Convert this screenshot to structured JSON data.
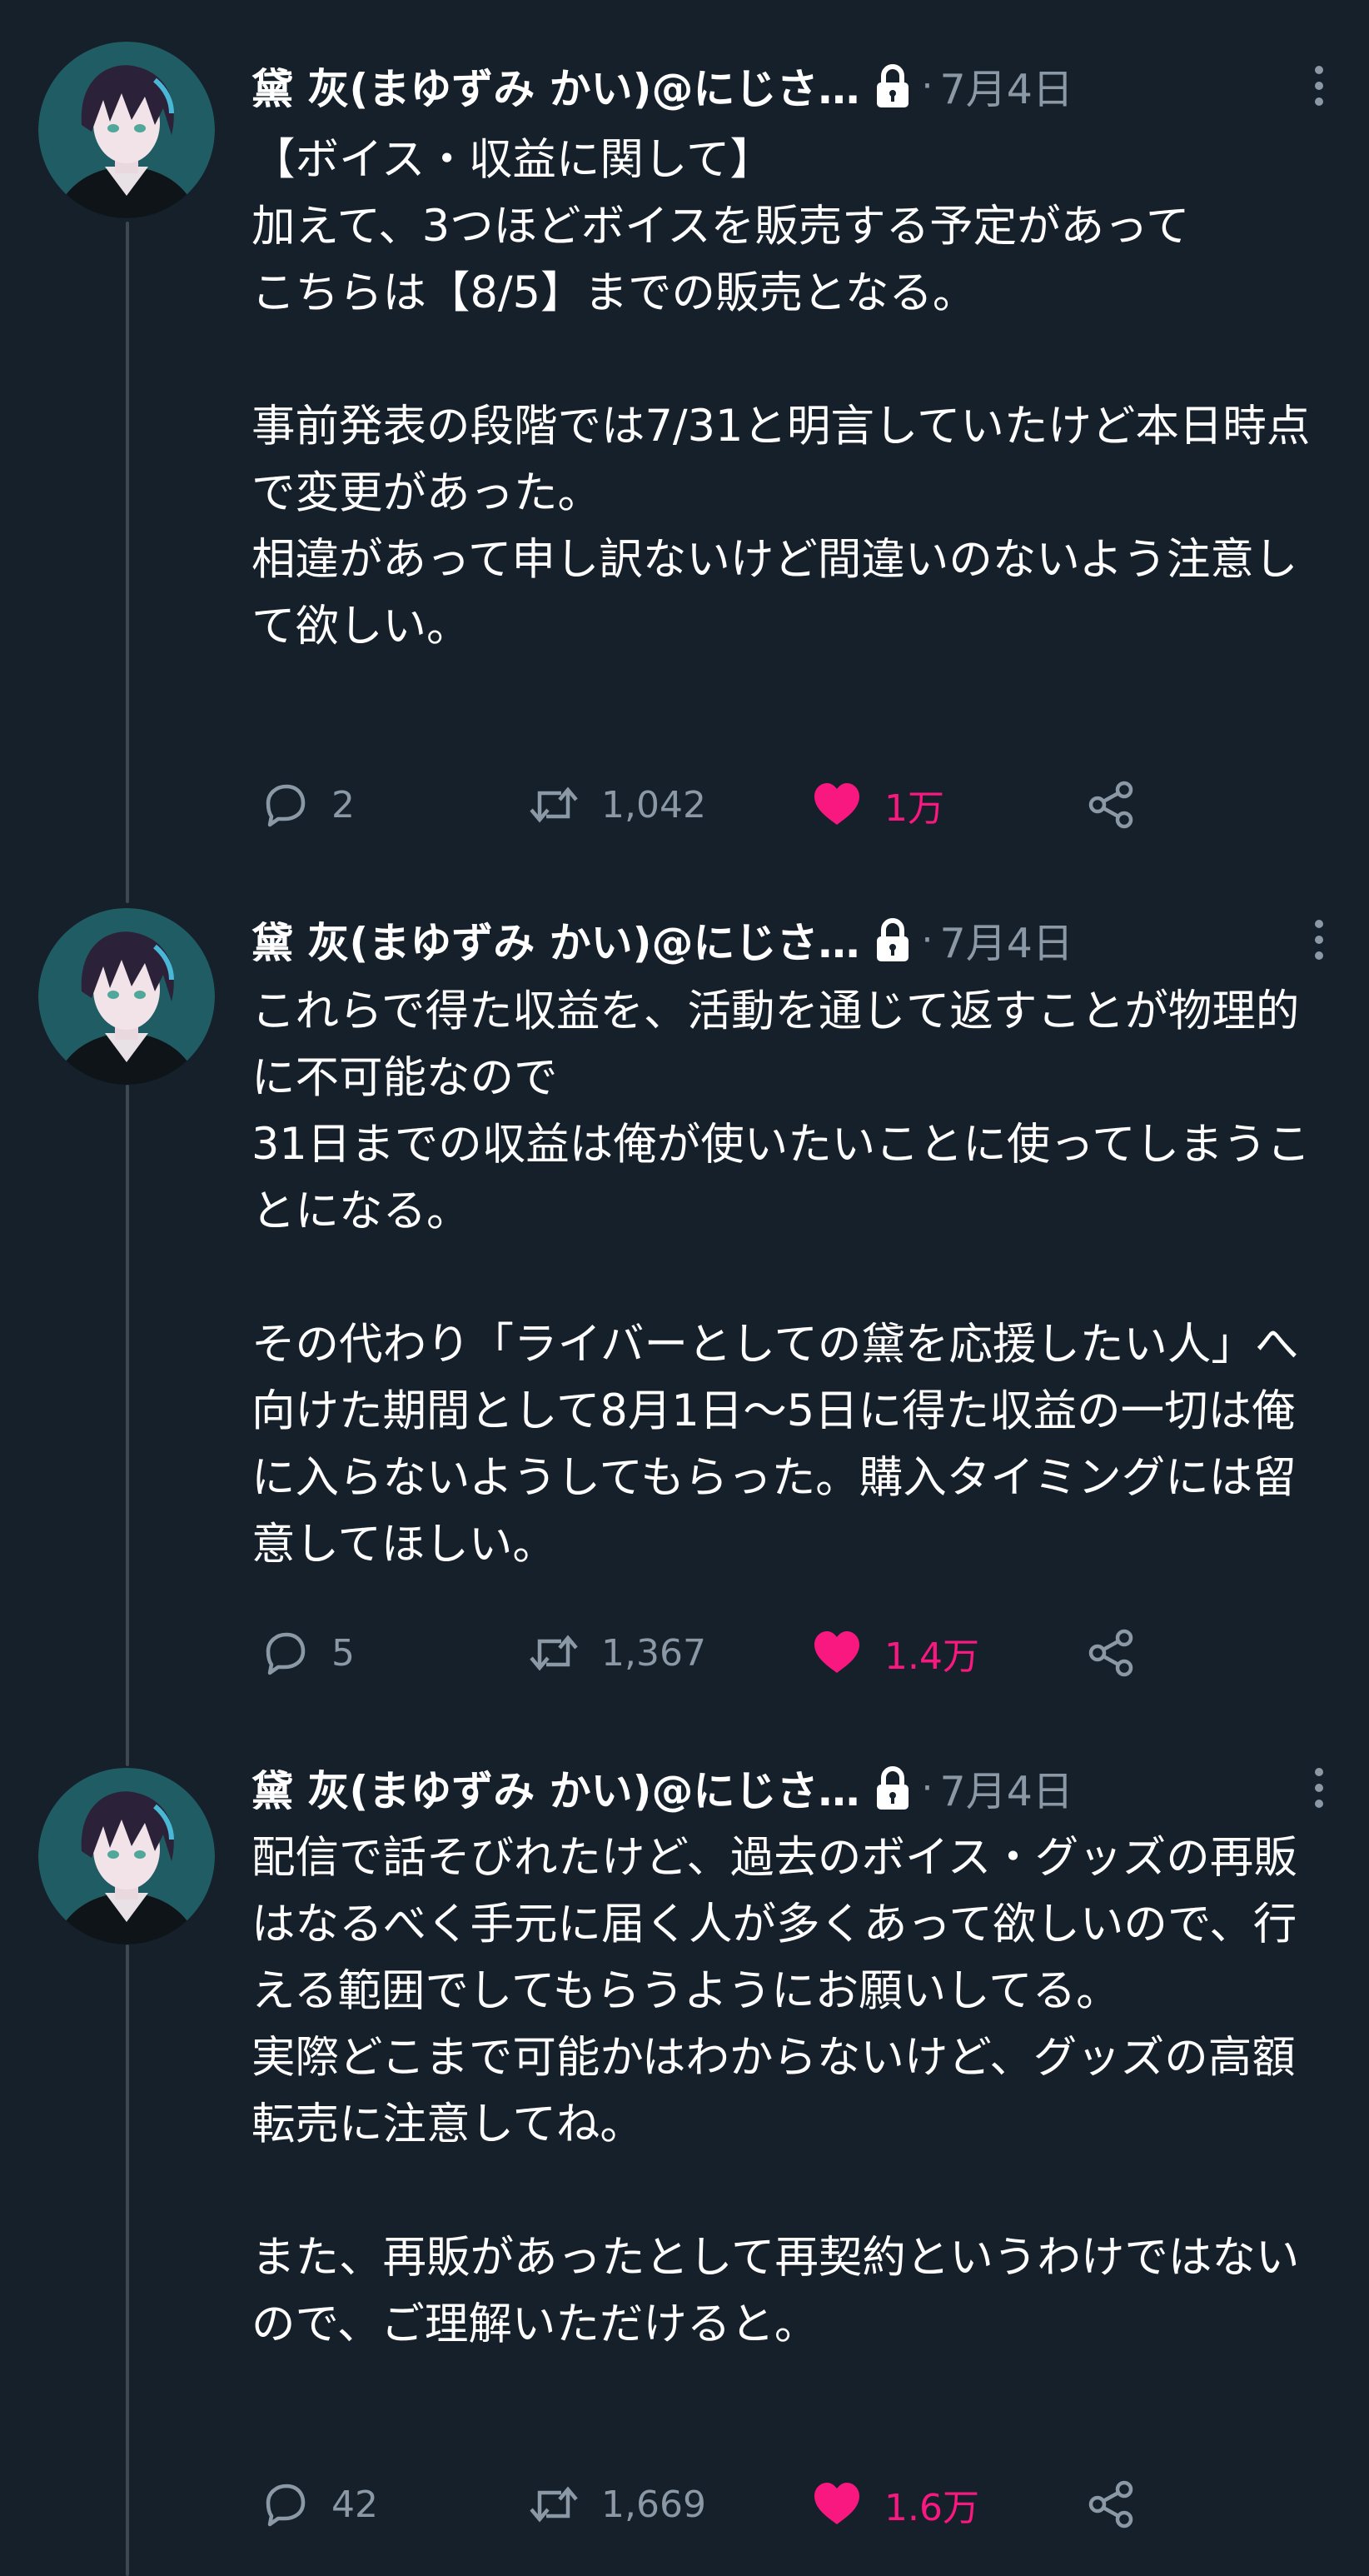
{
  "tweets": [
    {
      "display_name": "黛 灰(まゆずみ かい)@にじさ…",
      "separator": "·",
      "timestamp": "7月4日",
      "text": "【ボイス・収益に関して】\n加えて、3つほどボイスを販売する予定があって\nこちらは【8/5】までの販売となる。\n\n事前発表の段階では7/31と明言していたけど本日時点で変更があった。\n相違があって申し訳ないけど間違いのないよう注意して欲しい。",
      "replies": "2",
      "retweets": "1,042",
      "likes": "1万"
    },
    {
      "display_name": "黛 灰(まゆずみ かい)@にじさ…",
      "separator": "·",
      "timestamp": "7月4日",
      "text": "これらで得た収益を、活動を通じて返すことが物理的に不可能なので\n31日までの収益は俺が使いたいことに使ってしまうことになる。\n\nその代わり「ライバーとしての黛を応援したい人」へ向けた期間として8月1日～5日に得た収益の一切は俺に入らないようしてもらった。購入タイミングには留意してほしい。",
      "replies": "5",
      "retweets": "1,367",
      "likes": "1.4万"
    },
    {
      "display_name": "黛 灰(まゆずみ かい)@にじさ…",
      "separator": "·",
      "timestamp": "7月4日",
      "text": "配信で話そびれたけど、過去のボイス・グッズの再販はなるべく手元に届く人が多くあって欲しいので、行える範囲でしてもらうようにお願いしてる。\n実際どこまで可能かはわからないけど、グッズの高額転売に注意してね。\n\nまた、再販があったとして再契約というわけではないので、ご理解いただけると。",
      "replies": "42",
      "retweets": "1,669",
      "likes": "1.6万"
    }
  ],
  "colors": {
    "background": "#15202b",
    "text_primary": "#ffffff",
    "text_secondary": "#8b98a5",
    "thread_line": "#3d4852",
    "like_pink": "#f91880"
  },
  "icons": {
    "protected": "lock-icon",
    "more": "more-vertical-icon",
    "reply": "reply-icon",
    "retweet": "retweet-icon",
    "like": "heart-icon",
    "share": "share-icon"
  }
}
